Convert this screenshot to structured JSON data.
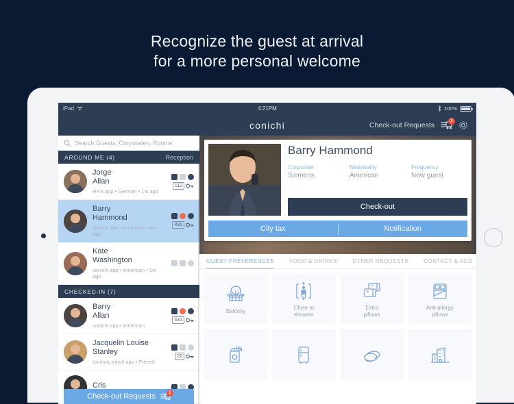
{
  "promo": {
    "line1": "Recognize the guest at arrival",
    "line2": "for a more personal welcome"
  },
  "colors": {
    "page_background": "#0b1a33",
    "header_navy": "#2d3e54",
    "accent_blue": "#6aa9e4",
    "tab_active": "#7fafe0",
    "badge_red": "#f2533c",
    "selected_row": "#b5d5f2"
  },
  "status_bar": {
    "device": "iPad",
    "wifi_icon": "wifi-icon",
    "time": "4:21PM",
    "bluetooth_icon": "bluetooth-icon",
    "battery_percent": "100%"
  },
  "app_bar": {
    "brand": "conichi",
    "checkout_requests_label": "Check-out Requests",
    "requests_icon": "checkout-requests-icon",
    "requests_badge": "1",
    "settings_icon": "gear-icon"
  },
  "sidebar": {
    "search_placeholder": "Search Guests, Corporates, Rooms",
    "search_icon": "search-icon",
    "sections": [
      {
        "title": "AROUND ME (4)",
        "right_label": "Reception",
        "guests": [
          {
            "first_name": "Jorge",
            "last_name": "Allan",
            "meta": "HRS app • German • 1m ago",
            "room": "112",
            "selected": false,
            "status_dots": [
              "dark",
              "gray",
              "dark"
            ]
          },
          {
            "first_name": "Barry",
            "last_name": "Hammond",
            "meta": "conichi app • American • 3m ago",
            "room": "431",
            "selected": true,
            "status_dots": [
              "dark",
              "red",
              "dark"
            ]
          },
          {
            "first_name": "Kate",
            "last_name": "Washington",
            "meta": "conichi app • American • 5m ago",
            "room": "",
            "selected": false,
            "status_dots": [
              "gray",
              "gray",
              "gray"
            ]
          }
        ]
      },
      {
        "title": "CHECKED-IN (7)",
        "right_label": "",
        "guests": [
          {
            "first_name": "Barry",
            "last_name": "Allan",
            "meta": "conichi app • American",
            "room": "431",
            "selected": false,
            "status_dots": [
              "dark",
              "red",
              "dark"
            ]
          },
          {
            "first_name": "Jacquelin Louise",
            "last_name": "Stanley",
            "meta": "touristic travel app • French",
            "room": "22",
            "selected": false,
            "status_dots": [
              "dark",
              "gray",
              "gray"
            ]
          },
          {
            "first_name": "Cris",
            "last_name": "",
            "meta": "",
            "room": "",
            "selected": false,
            "status_dots": [
              "dark",
              "gray",
              "dark"
            ]
          }
        ]
      }
    ],
    "checkout_bar": {
      "label": "Check-out Requests",
      "icon": "checkout-requests-icon",
      "badge": "1"
    }
  },
  "detail": {
    "guest_name": "Barry Hammond",
    "photo": "guest-photo",
    "fields": [
      {
        "label": "Corporate",
        "value": "Siemens"
      },
      {
        "label": "Nationality",
        "value": "American"
      },
      {
        "label": "Frequency",
        "value": "New guest"
      }
    ],
    "checkout_button": "Check-out",
    "actions": [
      {
        "label": "City tax"
      },
      {
        "label": "Notification"
      }
    ]
  },
  "tabs": [
    {
      "label": "GUEST PREFERENCES",
      "active": true
    },
    {
      "label": "FOOD & DRINKS",
      "active": false
    },
    {
      "label": "OTHER REQUESTS",
      "active": false
    },
    {
      "label": "CONTACT & ADD",
      "active": false
    }
  ],
  "preferences": [
    {
      "label": "Balcony",
      "icon": "balcony-icon"
    },
    {
      "label": "Close to\nelevator",
      "icon": "elevator-icon"
    },
    {
      "label": "Extra\npillows",
      "icon": "pillows-icon"
    },
    {
      "label": "Anti-allergy\npillows",
      "icon": "bed-icon"
    },
    {
      "label": "",
      "icon": "cigarettes-icon"
    },
    {
      "label": "",
      "icon": "fridge-icon"
    },
    {
      "label": "",
      "icon": "towels-icon"
    },
    {
      "label": "",
      "icon": "building-icon"
    }
  ]
}
